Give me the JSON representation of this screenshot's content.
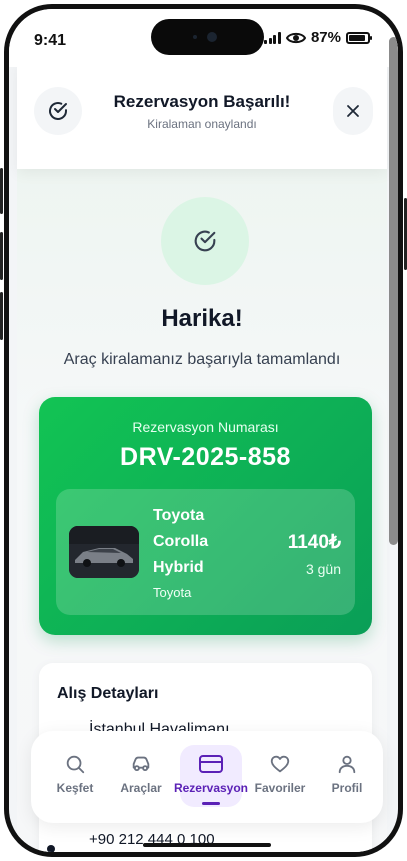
{
  "status": {
    "time": "9:41",
    "battery": "87%",
    "battery_level": 0.87
  },
  "header": {
    "title": "Rezervasyon Başarılı!",
    "subtitle": "Kiralaman onaylandı"
  },
  "success": {
    "heading": "Harika!",
    "message": "Araç kiralamanız başarıyla tamamlandı"
  },
  "reservation": {
    "label": "Rezervasyon Numarası",
    "number": "DRV-2025-858",
    "car": {
      "name_line1": "Toyota",
      "name_line2": "Corolla",
      "name_line3": "Hybrid",
      "brand": "Toyota",
      "price": "1140₺",
      "duration": "3 gün"
    }
  },
  "pickup": {
    "title": "Alış Detayları",
    "location": "İstanbul Havalimanı",
    "phone": "+90 212 444 0 100"
  },
  "nav": {
    "items": [
      {
        "label": "Keşfet",
        "icon": "search-icon"
      },
      {
        "label": "Araçlar",
        "icon": "car-icon"
      },
      {
        "label": "Rezervasyon",
        "icon": "credit-card-icon",
        "active": true
      },
      {
        "label": "Favoriler",
        "icon": "heart-icon"
      },
      {
        "label": "Profil",
        "icon": "user-icon"
      }
    ]
  },
  "colors": {
    "accent_green": "#12c454",
    "accent_purple": "#5b21b6",
    "text_dark": "#111827"
  }
}
